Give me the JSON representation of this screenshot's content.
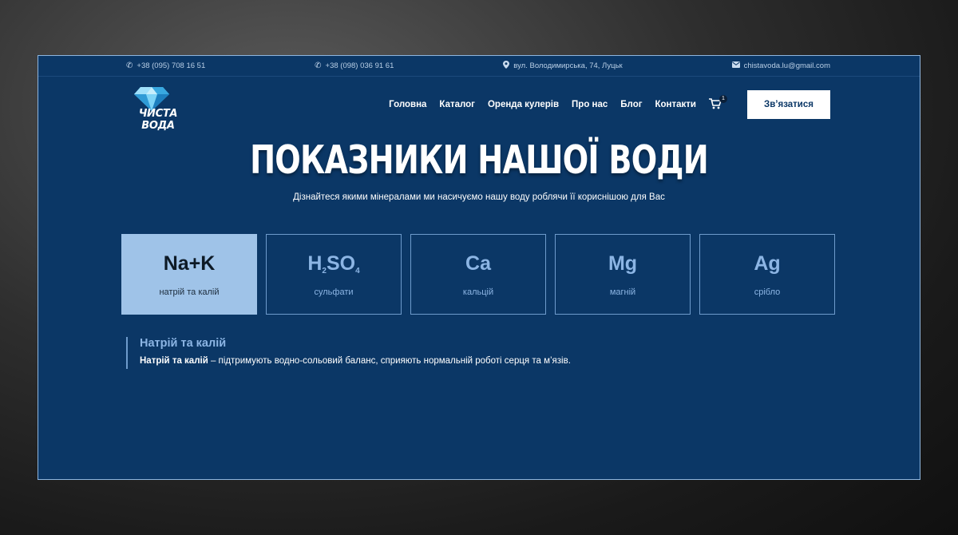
{
  "topbar": {
    "phone1": "+38 (095) 708 16 51",
    "phone2": "+38 (098) 036 91 61",
    "address": "вул. Володимирська, 74, Луцьк",
    "email": "chistavoda.lu@gmail.com",
    "icons": [
      "phone-icon",
      "phone-icon",
      "location-pin-icon",
      "mail-icon"
    ]
  },
  "logo": {
    "text": "ЧИСТА ВОДА"
  },
  "menu": {
    "items": [
      "Головна",
      "Каталог",
      "Оренда кулерів",
      "Про нас",
      "Блог",
      "Контакти"
    ]
  },
  "cart": {
    "count": "1"
  },
  "cta": {
    "label": "Зв’язатися"
  },
  "hero": {
    "title": "ПОКАЗНИКИ НАШОЇ ВОДИ",
    "subtitle": "Дізнайтеся якими мінералами ми насичуємо нашу воду роблячи її кориснішою для Вас"
  },
  "cards": [
    {
      "symbol": "Na+K",
      "name": "натрій та калій"
    },
    {
      "symbol_parts": [
        "H",
        "2",
        "SO",
        "4"
      ],
      "name": "сульфати"
    },
    {
      "symbol": "Ca",
      "name": "кальцій"
    },
    {
      "symbol": "Mg",
      "name": "магній"
    },
    {
      "symbol": "Ag",
      "name": "срібло"
    }
  ],
  "detail": {
    "title": "Натрій та калій",
    "bold": "Натрій та калій",
    "text": " – підтримують водно-сольовий баланс, сприяють нормальній роботі серця та м’язів."
  },
  "colors": {
    "background": "#0b3766",
    "accent": "#9fc3e8",
    "accent_text": "#8cb5e4"
  }
}
